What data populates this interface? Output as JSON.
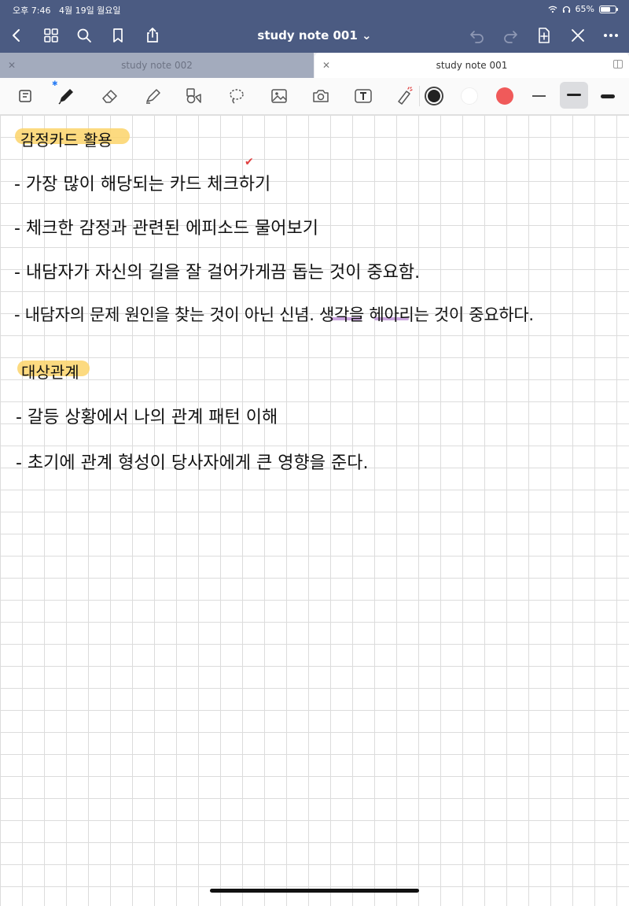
{
  "status_bar": {
    "time": "오후 7:46",
    "date": "4월 19일 월요일",
    "battery": "65%",
    "battery_level": 0.65
  },
  "header": {
    "title": "study note 001 ⌄"
  },
  "tabs": [
    {
      "label": "study note 002",
      "active": false
    },
    {
      "label": "study note 001",
      "active": true
    }
  ],
  "toolbar": {
    "bluetooth_glyph": "✱",
    "colors": [
      "#222222",
      "#ffffff",
      "#f05a5a"
    ],
    "icons": [
      "pages-icon",
      "pen-icon",
      "eraser-icon",
      "highlighter-icon",
      "shapes-icon",
      "lasso-icon",
      "image-icon",
      "camera-icon",
      "text-icon",
      "laser-pointer-icon"
    ]
  },
  "notes": {
    "section1": {
      "heading": "감정카드 활용",
      "items": [
        "- 가장 많이 해당되는 카드 체크하기",
        "- 체크한 감정과 관련된 에피소드 물어보기",
        "- 내담자가 자신의 길을 잘 걸어가게끔 돕는 것이 중요함.",
        "- 내담자의 문제 원인을 찾는 것이 아닌 신념. 생각을 헤아리는 것이 중요하다."
      ]
    },
    "section2": {
      "heading": "대상관계",
      "items": [
        "- 갈등 상황에서 나의 관계 패턴 이해",
        "- 초기에 관계 형성이 당사자에게 큰 영향을 준다."
      ]
    },
    "check_mark": "✔"
  }
}
